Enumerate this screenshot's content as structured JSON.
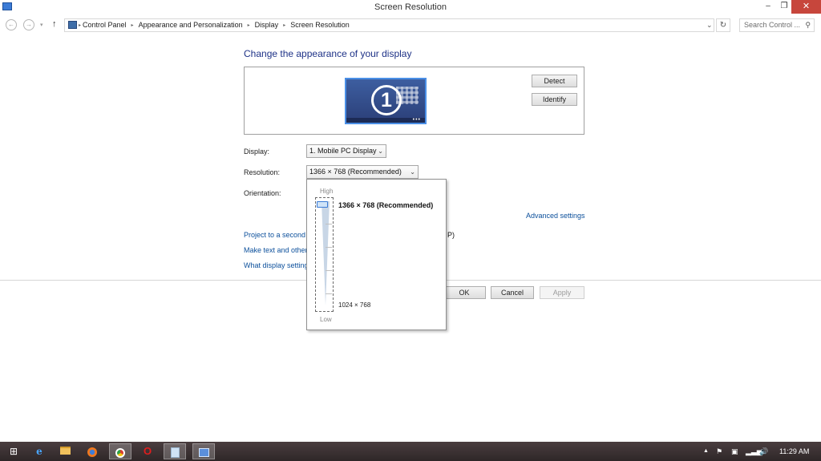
{
  "window": {
    "title": "Screen Resolution",
    "minimize_glyph": "–",
    "restore_glyph": "❐",
    "close_glyph": "✕"
  },
  "addressbar": {
    "back_glyph": "←",
    "forward_glyph": "→",
    "dropdown_glyph": "▾",
    "up_glyph": "↑",
    "breadcrumb": [
      "Control Panel",
      "Appearance and Personalization",
      "Display",
      "Screen Resolution"
    ],
    "separator_glyph": "▸",
    "history_dropdown_glyph": "⌄",
    "refresh_glyph": "↻",
    "search_placeholder": "Search Control ...",
    "search_glyph": "⚲"
  },
  "main": {
    "heading": "Change the appearance of your display",
    "monitor_number": "1",
    "monitor_dots": "•••",
    "detect_button": "Detect",
    "identify_button": "Identify",
    "display_label": "Display:",
    "display_value": "1. Mobile PC Display",
    "resolution_label": "Resolution:",
    "resolution_value": "1366 × 768 (Recommended)",
    "orientation_label": "Orientation:",
    "select_caret": "⌄",
    "advanced_link": "Advanced settings",
    "project_link": "Project to a second",
    "project_link_tail": "P)",
    "text_link": "Make text and other",
    "what_link": "What display setting",
    "ok_button": "OK",
    "cancel_button": "Cancel",
    "apply_button": "Apply"
  },
  "resolution_popup": {
    "high_label": "High",
    "low_label": "Low",
    "selected_option": "1366 × 768 (Recommended)",
    "lowest_option": "1024 × 768",
    "slider_level": 1.0
  },
  "taskbar": {
    "start_glyph": "⊞",
    "ie_glyph": "e",
    "opera_glyph": "O",
    "tray_up_glyph": "▲",
    "tray_flag_glyph": "⚑",
    "tray_net_glyph": "▣",
    "tray_signal_glyph": "▂▃▅",
    "tray_volume_glyph": "🔊",
    "clock": "11:29 AM"
  }
}
